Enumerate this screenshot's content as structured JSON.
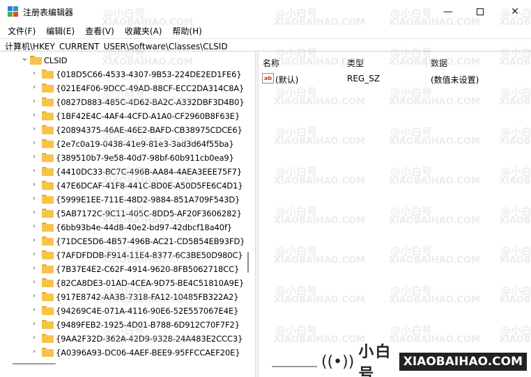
{
  "window": {
    "title": "注册表编辑器",
    "minimize_symbol": "—",
    "close_symbol": "✕"
  },
  "menu": [
    "文件(F)",
    "编辑(E)",
    "查看(V)",
    "收藏夹(A)",
    "帮助(H)"
  ],
  "address": "计算机\\HKEY_CURRENT_USER\\Software\\Classes\\CLSID",
  "tree": {
    "expanded_expander": "⌄",
    "collapsed_expander": "›",
    "parent": "CLSID",
    "children": [
      "{018D5C66-4533-4307-9B53-224DE2ED1FE6}",
      "{021E4F06-9DCC-49AD-88CF-ECC2DA314C8A}",
      "{0827D883-485C-4D62-BA2C-A332DBF3D4B0}",
      "{1BF42E4C-4AF4-4CFD-A1A0-CF2960B8F63E}",
      "{20894375-46AE-46E2-BAFD-CB38975CDCE6}",
      "{2e7c0a19-0438-41e9-81e3-3ad3d64f55ba}",
      "{389510b7-9e58-40d7-98bf-60b911cb0ea9}",
      "{4410DC33-BC7C-496B-AA84-4AEA3EEE75F7}",
      "{47E6DCAF-41F8-441C-BD0E-A50D5FE6C4D1}",
      "{5999E1EE-711E-48D2-9884-851A709F543D}",
      "{5AB7172C-9C11-405C-8DD5-AF20F3606282}",
      "{6bb93b4e-44d8-40e2-bd97-42dbcf18a40f}",
      "{71DCE5D6-4B57-496B-AC21-CD5B54EB93FD}",
      "{7AFDFDDB-F914-11E4-8377-6C3BE50D980C}",
      "{7B37E4E2-C62F-4914-9620-8FB5062718CC}",
      "{82CA8DE3-01AD-4CEA-9D75-BE4C51810A9E}",
      "{917E8742-AA3B-7318-FA12-10485FB322A2}",
      "{94269C4E-071A-4116-90E6-52E557067E4E}",
      "{9489FEB2-1925-4D01-B788-6D912C70F7F2}",
      "{9AA2F32D-362A-42D9-9328-24A483E2CCC3}",
      "{A0396A93-DC06-4AEF-BEE9-95FFCCAEF20E}"
    ]
  },
  "list": {
    "headers": {
      "name": "名称",
      "type": "类型",
      "data": "数据"
    },
    "rows": [
      {
        "icon": "ab",
        "name": "(默认)",
        "type": "REG_SZ",
        "data": "(数值未设置)"
      }
    ]
  },
  "watermark": {
    "cn": "@小白号",
    "en": "XIAOBAIHAO.COM",
    "icon": "((•))",
    "brand_cn": "小白号"
  },
  "colors": {
    "folder": "#f7c34b",
    "folder_tab": "#e6a92f",
    "icon_red": "#e8462f",
    "icon_green": "#4caf50",
    "icon_blue": "#2f7be8",
    "icon_teal": "#21a0b0"
  }
}
